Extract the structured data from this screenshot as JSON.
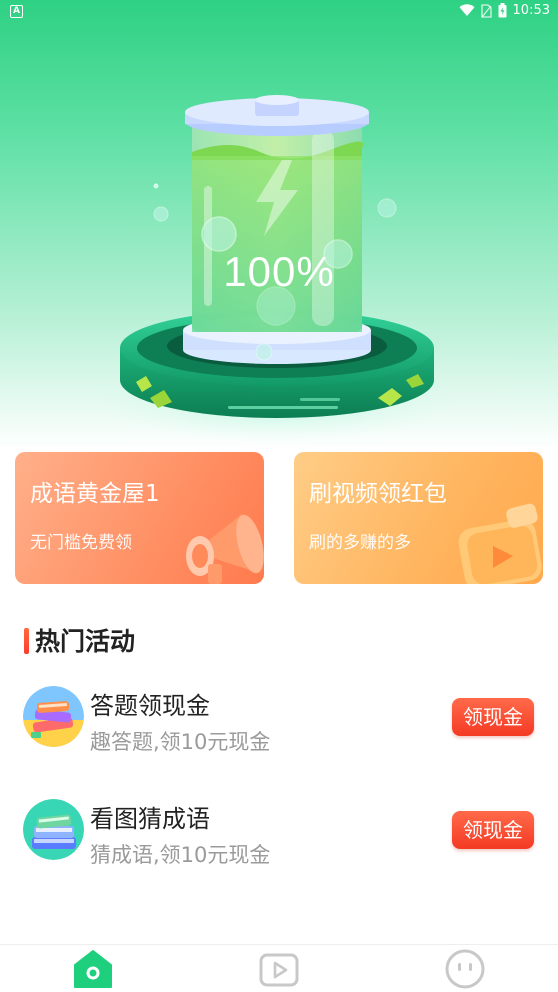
{
  "status_bar": {
    "app_indicator": "A",
    "time": "10:53"
  },
  "hero": {
    "battery_percent": "100%",
    "battery_level": 1.0
  },
  "promo_cards": [
    {
      "title": "成语黄金屋1",
      "subtitle": "无门槛免费领",
      "icon": "megaphone-icon"
    },
    {
      "title": "刷视频领红包",
      "subtitle": "刷的多赚的多",
      "icon": "video-play-icon"
    }
  ],
  "section": {
    "title": "热门活动",
    "accent_color": "#ff4a2f"
  },
  "activities": [
    {
      "title": "答题领现金",
      "subtitle": "趣答题,领10元现金",
      "button": "领现金",
      "icon": "books-icon"
    },
    {
      "title": "看图猜成语",
      "subtitle": "猜成语,领10元现金",
      "button": "领现金",
      "icon": "book-stack-icon"
    }
  ],
  "bottom_nav": [
    {
      "icon": "home-icon",
      "active": true
    },
    {
      "icon": "video-icon",
      "active": false
    },
    {
      "icon": "profile-face-icon",
      "active": false
    }
  ],
  "colors": {
    "brand_green": "#2ed183",
    "button_red": "#f43a24"
  }
}
